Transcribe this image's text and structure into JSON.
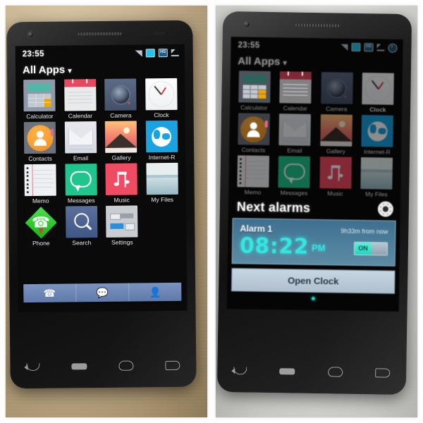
{
  "collage": {
    "panels": [
      {
        "id": "left",
        "description": "phone-showing-all-apps-drawer"
      },
      {
        "id": "right",
        "description": "phone-showing-next-alarms-dialog"
      }
    ]
  },
  "statusbar": {
    "time": "23:55",
    "icons_left_phone": [
      "signal-icon",
      "screen-icon",
      "hs-icon",
      "download-icon"
    ],
    "icons_right_phone": [
      "signal-icon",
      "screen-icon",
      "hs-icon",
      "download-icon",
      "alarm-clock-icon"
    ]
  },
  "header": {
    "title": "All Apps",
    "caret": "▾"
  },
  "apps": [
    {
      "label": "Calculator",
      "icon": "calculator-icon"
    },
    {
      "label": "Calendar",
      "icon": "calendar-icon"
    },
    {
      "label": "Camera",
      "icon": "camera-icon"
    },
    {
      "label": "Clock",
      "icon": "clock-icon"
    },
    {
      "label": "Contacts",
      "icon": "contacts-icon"
    },
    {
      "label": "Email",
      "icon": "email-icon"
    },
    {
      "label": "Gallery",
      "icon": "gallery-icon"
    },
    {
      "label": "Internet-R",
      "icon": "internet-icon"
    },
    {
      "label": "Memo",
      "icon": "memo-icon"
    },
    {
      "label": "Messages",
      "icon": "messages-icon"
    },
    {
      "label": "Music",
      "icon": "music-icon"
    },
    {
      "label": "My Files",
      "icon": "myfiles-icon"
    },
    {
      "label": "Phone",
      "icon": "phone-icon"
    },
    {
      "label": "Search",
      "icon": "search-icon"
    },
    {
      "label": "Settings",
      "icon": "settings-icon"
    }
  ],
  "dock": {
    "items": [
      {
        "name": "phone-shortcut",
        "glyph": "✆"
      },
      {
        "name": "messages-shortcut",
        "glyph": "◯"
      },
      {
        "name": "add-contact-shortcut",
        "glyph": "☰"
      }
    ]
  },
  "navbar": {
    "items": [
      "back-button",
      "menu-button",
      "home-button",
      "recents-button"
    ]
  },
  "dialog": {
    "title": "Next alarms",
    "settings_icon": "gear-icon",
    "alarm": {
      "name": "Alarm 1",
      "when": "9h33m from now",
      "time": "08:22",
      "ampm": "PM",
      "toggle_label": "ON",
      "toggle_state": "on"
    },
    "open_clock_label": "Open Clock",
    "page_indicator": "page-dot"
  },
  "colors": {
    "alarm_cyan": "#34e6e0",
    "toggle_on": "#1fd6bd",
    "dock_blue": "#6f8bb7",
    "card_blue": "#4a7c99",
    "button_grey": "#b9cada"
  }
}
